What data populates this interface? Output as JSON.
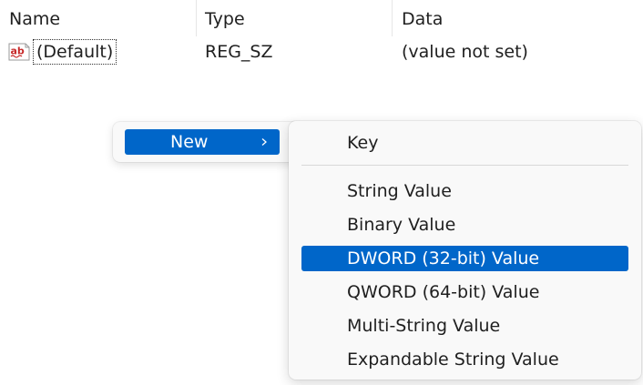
{
  "columns": {
    "name": "Name",
    "type": "Type",
    "data": "Data"
  },
  "values": [
    {
      "icon": "reg-string-ab-icon",
      "name": "(Default)",
      "type": "REG_SZ",
      "data": "(value not set)"
    }
  ],
  "context_menu": {
    "new_label": "New",
    "new_icon": "chevron-right-icon"
  },
  "submenu": {
    "items": [
      "Key",
      "String Value",
      "Binary Value",
      "DWORD (32-bit) Value",
      "QWORD (64-bit) Value",
      "Multi-String Value",
      "Expandable String Value"
    ],
    "selected": "DWORD (32-bit) Value"
  },
  "colors": {
    "highlight": "#0066c9",
    "menu_background": "#f9f9f9",
    "highlight_text": "#ffffff"
  }
}
